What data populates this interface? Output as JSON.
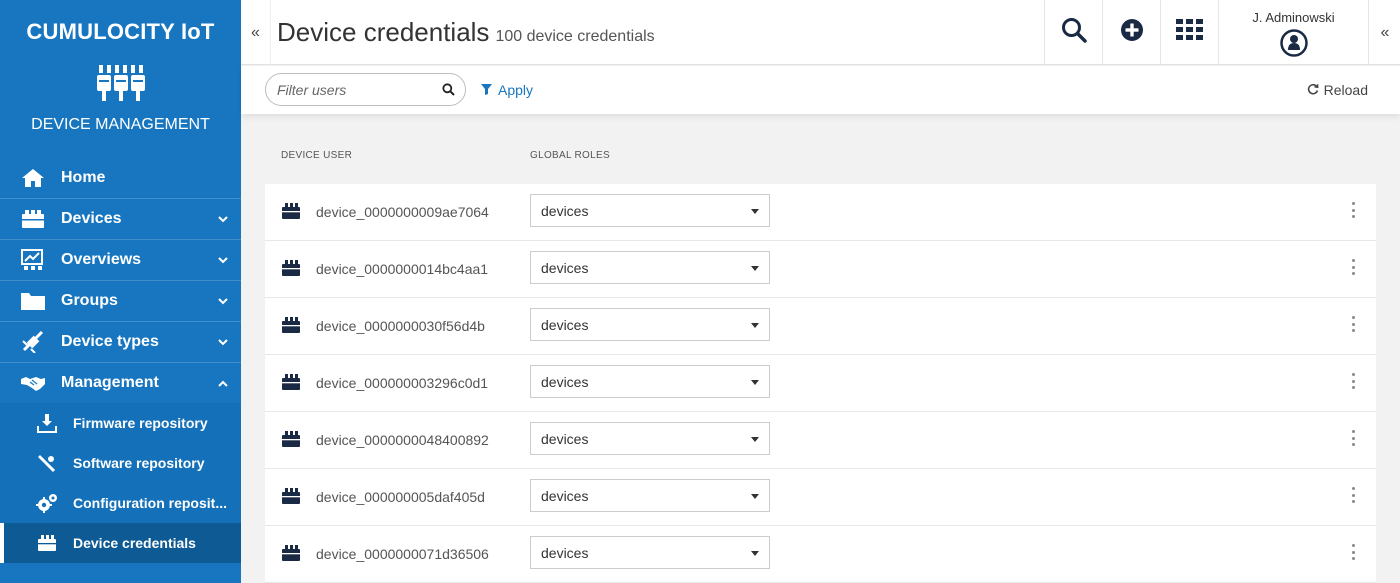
{
  "sidebar": {
    "brand": "CUMULOCITY IoT",
    "app_name": "DEVICE MANAGEMENT",
    "items": [
      {
        "label": "Home",
        "icon": "home-icon"
      },
      {
        "label": "Devices",
        "icon": "devices-icon"
      },
      {
        "label": "Overviews",
        "icon": "overviews-icon"
      },
      {
        "label": "Groups",
        "icon": "folder-icon"
      },
      {
        "label": "Device types",
        "icon": "device-types-icon"
      },
      {
        "label": "Management",
        "icon": "handshake-icon"
      }
    ],
    "sub_items": [
      {
        "label": "Firmware repository",
        "icon": "download-icon"
      },
      {
        "label": "Software repository",
        "icon": "software-icon"
      },
      {
        "label": "Configuration reposit...",
        "icon": "gears-icon"
      },
      {
        "label": "Device credentials",
        "icon": "credentials-icon"
      }
    ],
    "colors": {
      "background": "#1776bf",
      "active": "#0d5a95"
    }
  },
  "header": {
    "collapse_left": "«",
    "title": "Device credentials",
    "subtitle": "100 device credentials",
    "user_name": "J. Adminowski",
    "collapse_right": "«"
  },
  "toolbar": {
    "filter_placeholder": "Filter users",
    "apply_label": "Apply",
    "reload_label": "Reload"
  },
  "table": {
    "columns": [
      "DEVICE USER",
      "GLOBAL ROLES"
    ],
    "rows": [
      {
        "user": "device_0000000009ae7064",
        "role": "devices"
      },
      {
        "user": "device_0000000014bc4aa1",
        "role": "devices"
      },
      {
        "user": "device_0000000030f56d4b",
        "role": "devices"
      },
      {
        "user": "device_000000003296c0d1",
        "role": "devices"
      },
      {
        "user": "device_0000000048400892",
        "role": "devices"
      },
      {
        "user": "device_000000005daf405d",
        "role": "devices"
      },
      {
        "user": "device_0000000071d36506",
        "role": "devices"
      }
    ]
  }
}
